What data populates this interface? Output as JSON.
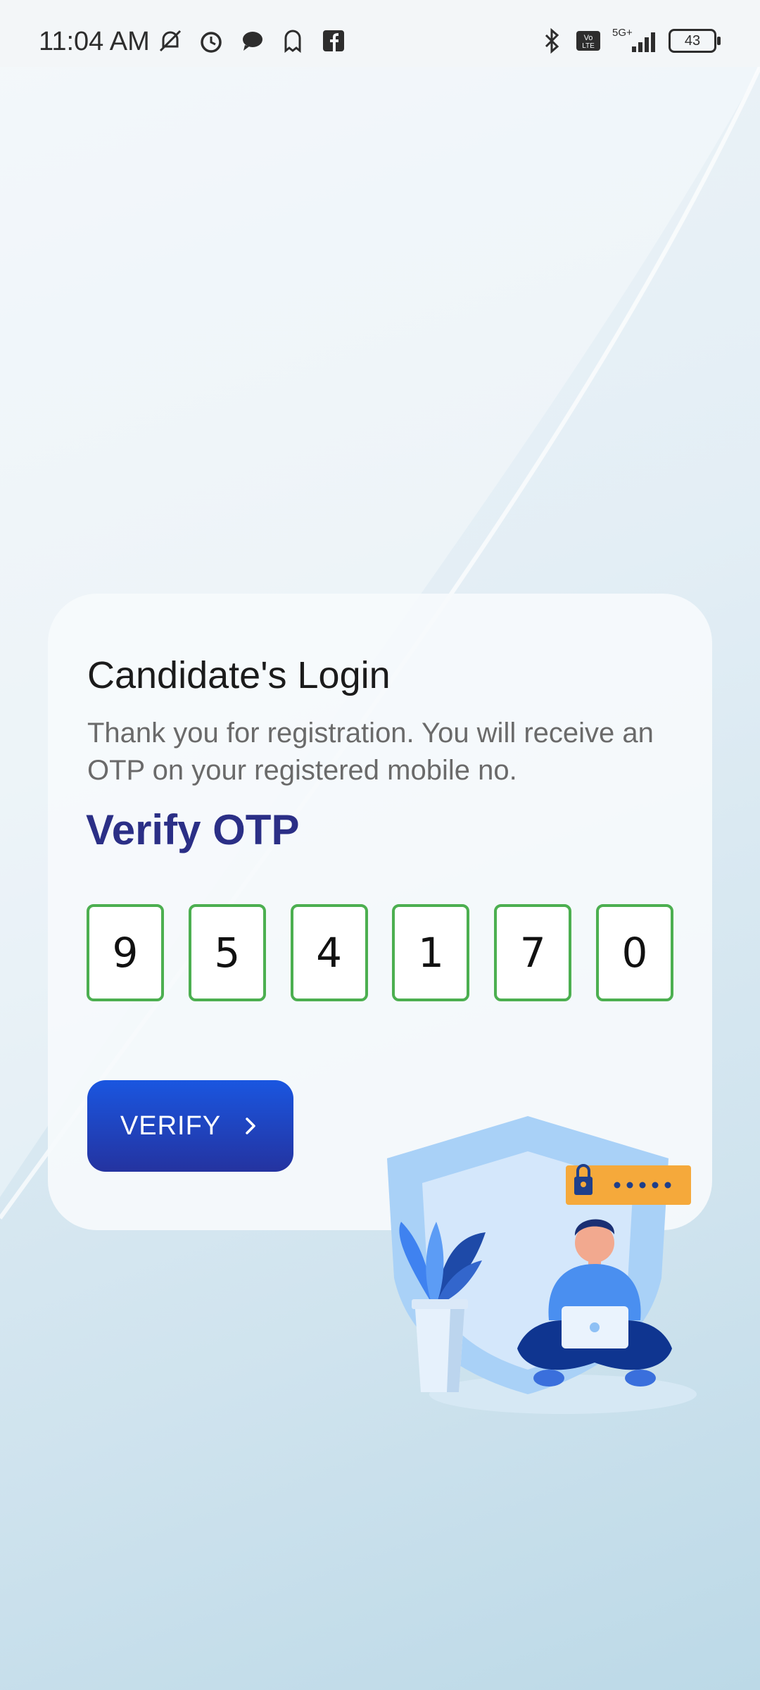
{
  "status_bar": {
    "time": "11:04 AM",
    "battery": "43",
    "network": "5G+",
    "left_icons": [
      "mute-icon",
      "alarm-icon",
      "chat-icon",
      "ghost-icon",
      "facebook-icon"
    ],
    "right_icons": [
      "bluetooth-icon",
      "volte-icon",
      "signal-icon",
      "battery-icon"
    ]
  },
  "card": {
    "title": "Candidate's Login",
    "subtitle": "Thank you for registration. You will receive an OTP on your registered mobile no.",
    "verify_heading": "Verify OTP",
    "otp_digits": [
      "9",
      "5",
      "4",
      "1",
      "7",
      "0"
    ],
    "verify_button": "VERIFY"
  },
  "colors": {
    "accent": "#2b2f86",
    "button_top": "#1a56e0",
    "button_bottom": "#2433a0",
    "otp_border": "#4caf50"
  }
}
